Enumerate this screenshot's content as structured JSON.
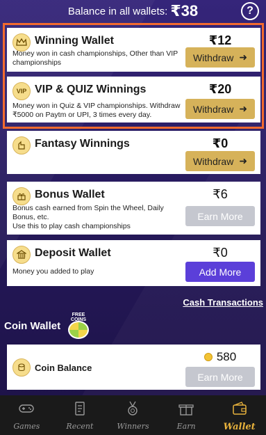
{
  "header": {
    "balance_label": "Balance in all wallets:",
    "balance_amount": "₹38",
    "help_icon": "?"
  },
  "wallets": [
    {
      "title": "Winning Wallet",
      "description": "Money won in cash championships, Other than VIP championships",
      "amount": "₹12",
      "button": "Withdraw",
      "icon": "crown-icon"
    },
    {
      "title": "VIP & QUIZ Winnings",
      "description": "Money won in Quiz & VIP championships. Withdraw ₹5000 on Paytm or UPI, 3 times every day.",
      "amount": "₹20",
      "button": "Withdraw",
      "icon_text": "VIP"
    },
    {
      "title": "Fantasy Winnings",
      "description": "",
      "amount": "₹0",
      "button": "Withdraw",
      "icon": "fantasy-icon"
    },
    {
      "title": "Bonus Wallet",
      "description": "Bonus cash earned from Spin the Wheel, Daily Bonus, etc.\nUse this to play cash championships",
      "amount": "₹6",
      "button": "Earn More",
      "icon": "bonus-icon"
    },
    {
      "title": "Deposit Wallet",
      "description": "Money you added to play",
      "amount": "₹0",
      "button": "Add More",
      "icon": "bank-icon"
    }
  ],
  "links": {
    "cash_transactions": "Cash Transactions"
  },
  "coin_wallet": {
    "title": "Coin Wallet",
    "free_coins_label": "FREE COINS",
    "balance_title": "Coin Balance",
    "balance_value": "580",
    "button": "Earn More"
  },
  "nav": [
    {
      "label": "Games",
      "icon": "gamepad-icon"
    },
    {
      "label": "Recent",
      "icon": "recent-icon"
    },
    {
      "label": "Winners",
      "icon": "medal-icon"
    },
    {
      "label": "Earn",
      "icon": "gift-icon"
    },
    {
      "label": "Wallet",
      "icon": "wallet-icon",
      "active": true
    }
  ],
  "colors": {
    "background": "#2a1d63",
    "highlight_border": "#f26a2e",
    "withdraw_button": "#d6b25a",
    "earn_more_button": "#c5c7cf",
    "add_more_button": "#5b3fd9",
    "active_nav": "#e8b23c"
  }
}
